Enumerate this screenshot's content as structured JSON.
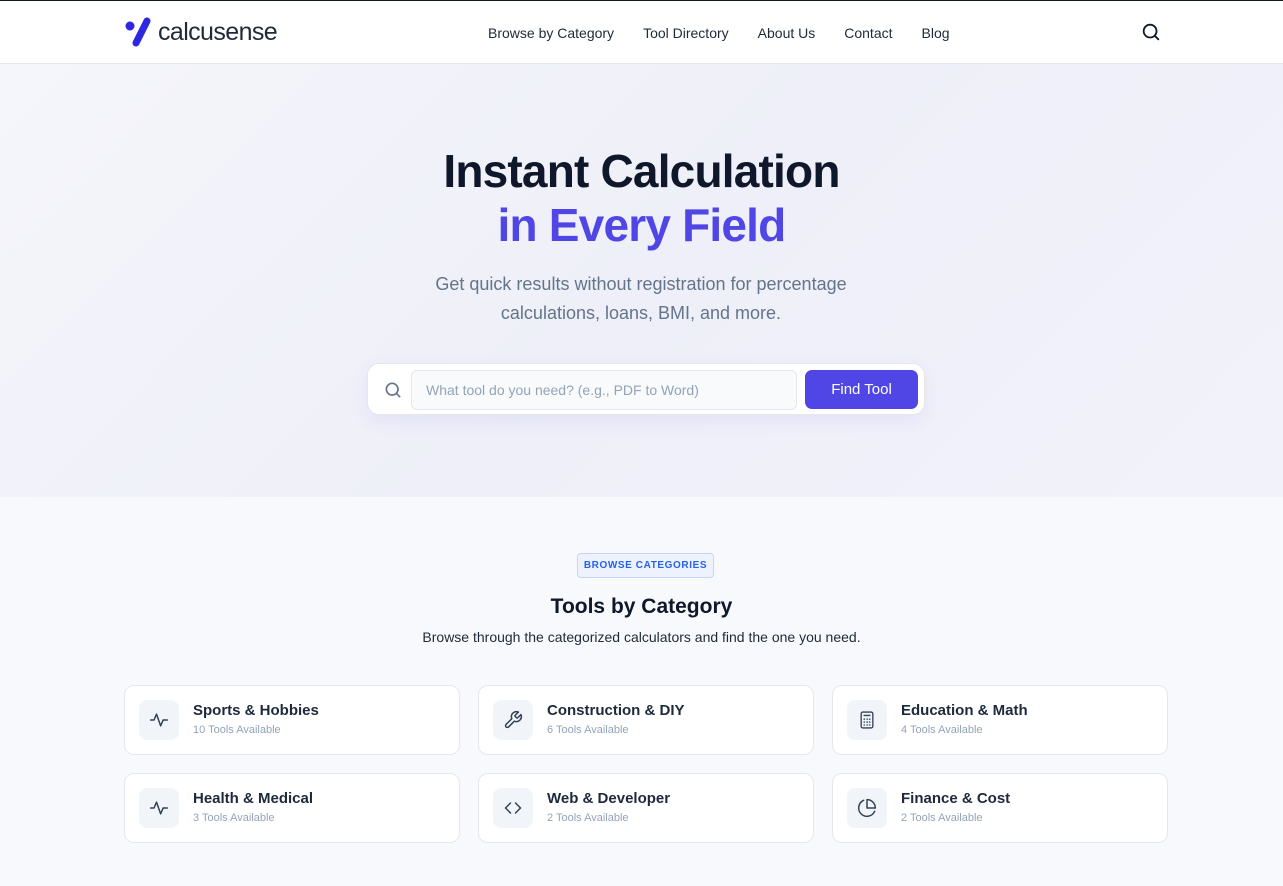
{
  "header": {
    "brand": "calcusense",
    "nav": [
      "Browse by Category",
      "Tool Directory",
      "About Us",
      "Contact",
      "Blog"
    ],
    "search_icon": "search-icon"
  },
  "hero": {
    "title_line1": "Instant Calculation",
    "title_line2": "in Every Field",
    "subtitle": "Get quick results without registration for percentage calculations, loans, BMI, and more.",
    "search_placeholder": "What tool do you need? (e.g., PDF to Word)",
    "search_value": "",
    "button_label": "Find Tool"
  },
  "categories": {
    "badge": "BROWSE CATEGORIES",
    "title": "Tools by Category",
    "subtitle": "Browse through the categorized calculators and find the one you need.",
    "items": [
      {
        "title": "Sports & Hobbies",
        "count": "10 Tools Available",
        "icon": "activity-icon"
      },
      {
        "title": "Construction & DIY",
        "count": "6 Tools Available",
        "icon": "wrench-icon"
      },
      {
        "title": "Education & Math",
        "count": "4 Tools Available",
        "icon": "calculator-icon"
      },
      {
        "title": "Health & Medical",
        "count": "3 Tools Available",
        "icon": "activity-icon"
      },
      {
        "title": "Web & Developer",
        "count": "2 Tools Available",
        "icon": "code-icon"
      },
      {
        "title": "Finance & Cost",
        "count": "2 Tools Available",
        "icon": "pie-chart-icon"
      }
    ]
  },
  "colors": {
    "accent": "#4f46e5",
    "badge_text": "#2563eb",
    "text_dark": "#0f172a",
    "text_muted": "#64748b"
  }
}
